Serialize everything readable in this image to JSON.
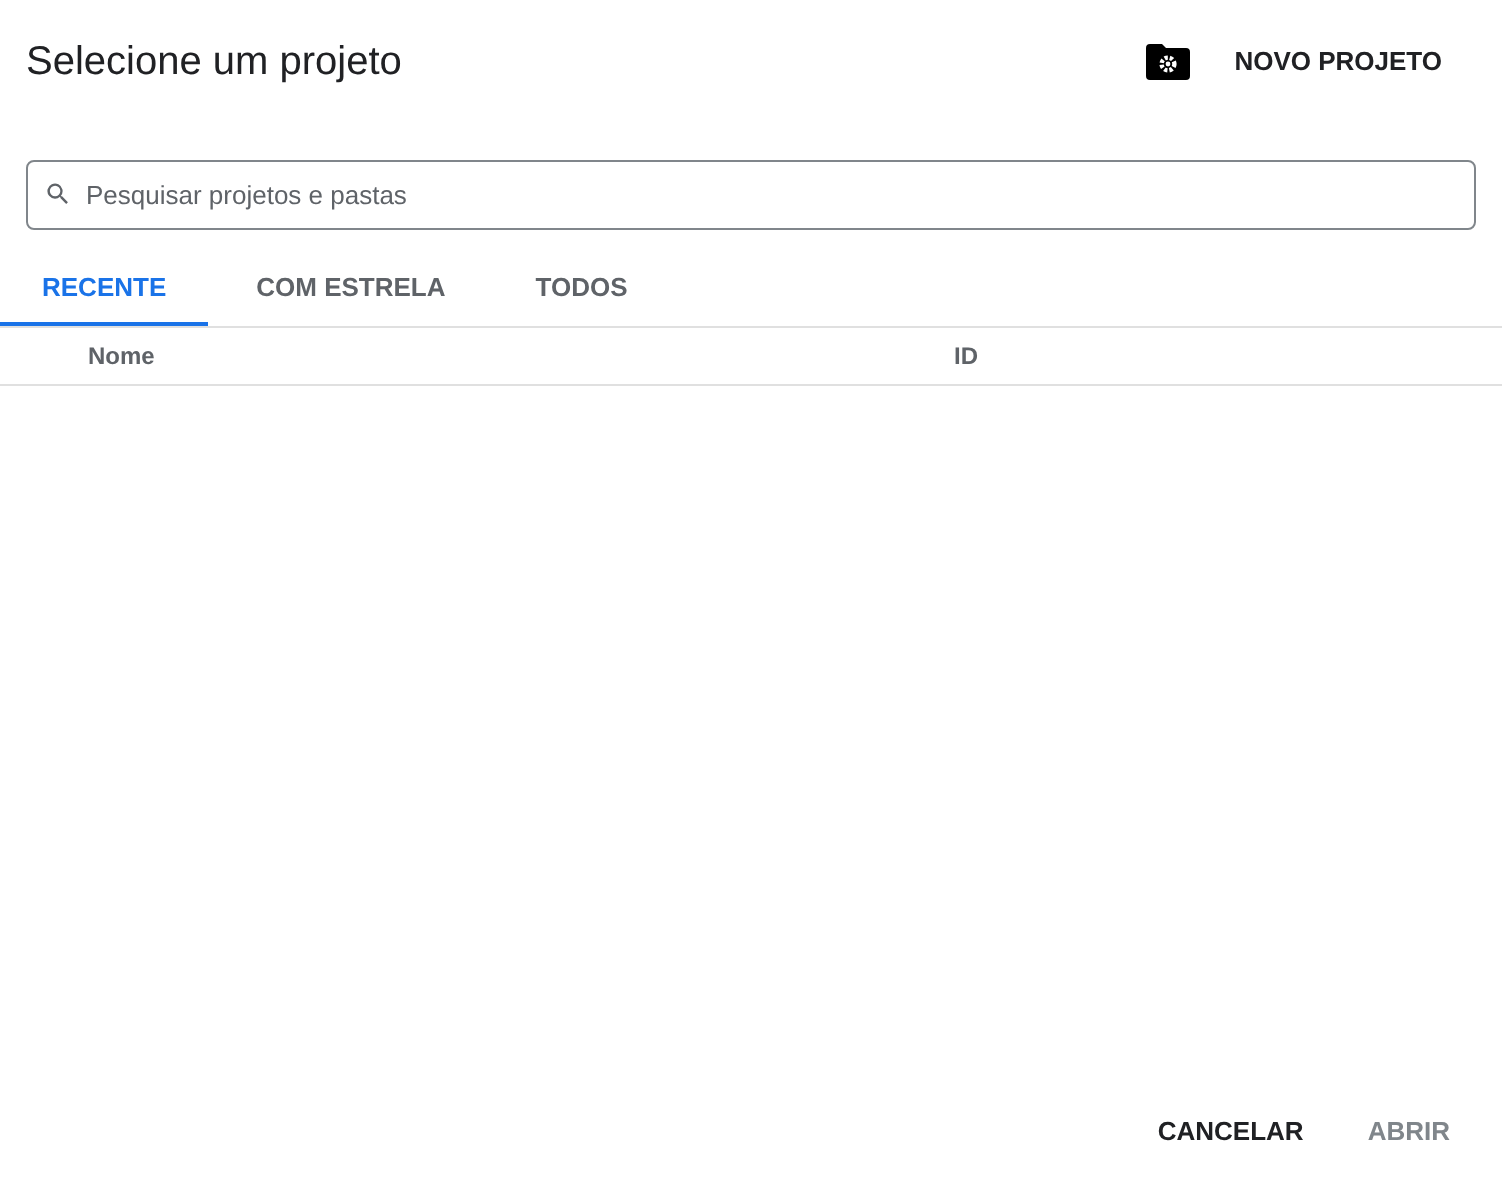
{
  "title": "Selecione um projeto",
  "new_project_button": "NOVO PROJETO",
  "search": {
    "placeholder": "Pesquisar projetos e pastas"
  },
  "tabs": [
    {
      "label": "RECENTE",
      "selected": true
    },
    {
      "label": "COM ESTRELA",
      "selected": false
    },
    {
      "label": "TODOS",
      "selected": false
    }
  ],
  "table": {
    "columns": [
      "Nome",
      "ID"
    ]
  },
  "buttons": [
    {
      "label": "CANCELAR",
      "disabled": false
    },
    {
      "label": "ABRIR",
      "disabled": true
    }
  ]
}
